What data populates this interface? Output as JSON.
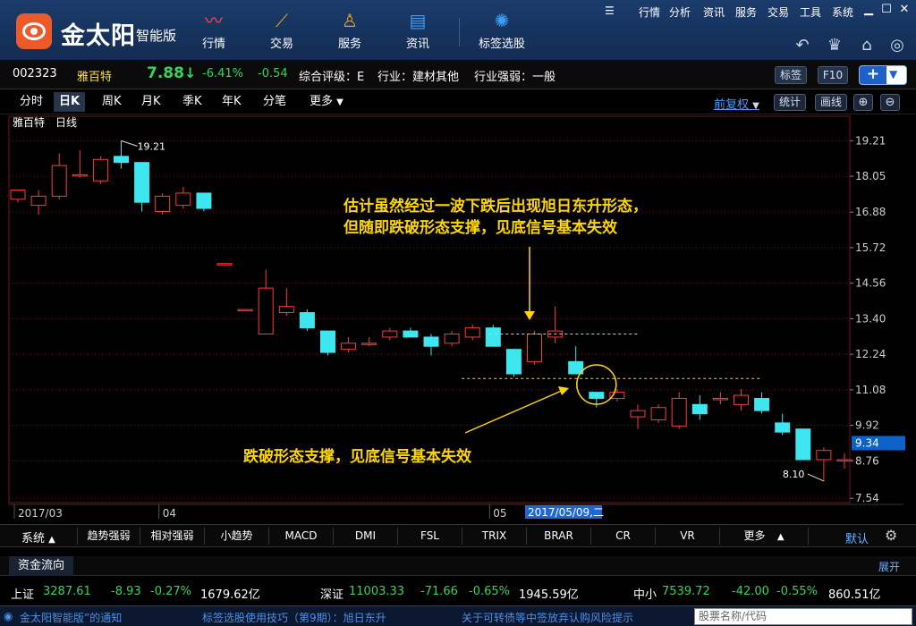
{
  "app": {
    "logo_text": "金太阳",
    "logo_subtitle": "智能版"
  },
  "nav": [
    {
      "label": "行情",
      "icon": "trend-line-icon"
    },
    {
      "label": "交易",
      "icon": "trade-icon"
    },
    {
      "label": "服务",
      "icon": "person-icon"
    },
    {
      "label": "资讯",
      "icon": "news-icon"
    },
    {
      "label": "标签选股",
      "icon": "bulb-icon"
    }
  ],
  "system_menu": [
    "行情",
    "分析",
    "资讯",
    "服务",
    "交易",
    "工具",
    "系统"
  ],
  "stock": {
    "code": "002323",
    "name": "雅百特",
    "price": "7.88",
    "arrow": "↓",
    "change_pct": "-6.41%",
    "change": "-0.54",
    "rating": "综合评级：E",
    "industry": "行业：建材其他",
    "industry_strength": "行业强弱：一般"
  },
  "info_buttons": {
    "tag": "标签",
    "f10": "F10",
    "plus": "+"
  },
  "period_tabs": [
    "分时",
    "日K",
    "周K",
    "月K",
    "季K",
    "年K",
    "分笔",
    "更多"
  ],
  "active_period": "日K",
  "right_tools": {
    "adjust": "前复权",
    "stats": "统计",
    "draw": "画线"
  },
  "chart_data": {
    "type": "candlestick",
    "title": "雅百特",
    "subtitle": "日线",
    "ylim": [
      7.34,
      19.6
    ],
    "y_ticks": [
      "19.21",
      "18.05",
      "16.88",
      "15.72",
      "14.56",
      "13.40",
      "12.24",
      "11.08",
      "9.92",
      "8.76",
      "7.54"
    ],
    "x_labels": [
      {
        "label": "2017/03",
        "index": 0
      },
      {
        "label": "04",
        "index": 7
      },
      {
        "label": "05",
        "index": 23
      }
    ],
    "crosshair_date": "2017/05/09,二",
    "current_value_tag": "9.34",
    "high_label": "19.21",
    "low_label": "8.10",
    "candles": [
      {
        "o": 17.3,
        "h": 17.6,
        "l": 17.2,
        "c": 17.6
      },
      {
        "o": 17.1,
        "h": 17.6,
        "l": 16.8,
        "c": 17.4
      },
      {
        "o": 17.4,
        "h": 18.8,
        "l": 17.3,
        "c": 18.4
      },
      {
        "o": 18.1,
        "h": 18.9,
        "l": 18.0,
        "c": 18.1
      },
      {
        "o": 17.9,
        "h": 18.7,
        "l": 17.8,
        "c": 18.6
      },
      {
        "o": 18.7,
        "h": 19.21,
        "l": 18.3,
        "c": 18.5
      },
      {
        "o": 18.5,
        "h": 18.5,
        "l": 16.9,
        "c": 17.2
      },
      {
        "o": 16.9,
        "h": 17.5,
        "l": 16.8,
        "c": 17.4
      },
      {
        "o": 17.1,
        "h": 17.7,
        "l": 17.0,
        "c": 17.5
      },
      {
        "o": 17.5,
        "h": 17.5,
        "l": 16.9,
        "c": 17.0
      },
      {
        "o": 15.2,
        "h": 15.2,
        "l": 15.2,
        "c": 15.2
      },
      {
        "o": 13.7,
        "h": 13.7,
        "l": 13.7,
        "c": 13.7
      },
      {
        "o": 12.9,
        "h": 15.0,
        "l": 12.9,
        "c": 14.4
      },
      {
        "o": 13.6,
        "h": 14.4,
        "l": 13.5,
        "c": 13.8
      },
      {
        "o": 13.6,
        "h": 13.7,
        "l": 13.0,
        "c": 13.1
      },
      {
        "o": 13.0,
        "h": 13.0,
        "l": 12.2,
        "c": 12.3
      },
      {
        "o": 12.4,
        "h": 12.8,
        "l": 12.3,
        "c": 12.6
      },
      {
        "o": 12.6,
        "h": 12.8,
        "l": 12.5,
        "c": 12.6
      },
      {
        "o": 12.8,
        "h": 13.1,
        "l": 12.7,
        "c": 13.0
      },
      {
        "o": 13.0,
        "h": 13.1,
        "l": 12.8,
        "c": 12.8
      },
      {
        "o": 12.8,
        "h": 12.9,
        "l": 12.2,
        "c": 12.5
      },
      {
        "o": 12.6,
        "h": 13.0,
        "l": 12.5,
        "c": 12.9
      },
      {
        "o": 12.8,
        "h": 13.2,
        "l": 12.7,
        "c": 13.1
      },
      {
        "o": 13.1,
        "h": 13.2,
        "l": 12.5,
        "c": 12.5
      },
      {
        "o": 12.4,
        "h": 12.4,
        "l": 11.5,
        "c": 11.6
      },
      {
        "o": 12.0,
        "h": 13.0,
        "l": 11.9,
        "c": 12.9
      },
      {
        "o": 12.8,
        "h": 13.8,
        "l": 12.6,
        "c": 13.0
      },
      {
        "o": 12.0,
        "h": 12.5,
        "l": 11.6,
        "c": 11.6
      },
      {
        "o": 11.0,
        "h": 11.0,
        "l": 10.5,
        "c": 10.8
      },
      {
        "o": 10.8,
        "h": 11.1,
        "l": 10.7,
        "c": 11.0
      },
      {
        "o": 10.2,
        "h": 10.6,
        "l": 9.8,
        "c": 10.4
      },
      {
        "o": 10.1,
        "h": 10.6,
        "l": 10.0,
        "c": 10.5
      },
      {
        "o": 9.9,
        "h": 11.0,
        "l": 9.8,
        "c": 10.8
      },
      {
        "o": 10.6,
        "h": 10.9,
        "l": 10.1,
        "c": 10.3
      },
      {
        "o": 10.8,
        "h": 11.0,
        "l": 10.6,
        "c": 10.8
      },
      {
        "o": 10.6,
        "h": 11.1,
        "l": 10.4,
        "c": 10.9
      },
      {
        "o": 10.8,
        "h": 11.0,
        "l": 10.3,
        "c": 10.4
      },
      {
        "o": 10.0,
        "h": 10.3,
        "l": 9.6,
        "c": 9.7
      },
      {
        "o": 9.8,
        "h": 9.8,
        "l": 8.8,
        "c": 8.8
      },
      {
        "o": 8.8,
        "h": 9.2,
        "l": 8.1,
        "c": 9.1
      },
      {
        "o": 8.8,
        "h": 9.0,
        "l": 8.5,
        "c": 8.8
      }
    ],
    "annotations": [
      {
        "text": "估计虽然经过一波下跌后出现旭日东升形态，",
        "color": "#ffd700"
      },
      {
        "text": "但随即跌破形态支撑，见底信号基本失效",
        "color": "#ffd700"
      },
      {
        "text": "跌破形态支撑，见底信号基本失效",
        "color": "#ffd700"
      }
    ],
    "dashed_levels": [
      12.9,
      11.45
    ],
    "colors": {
      "up": "#ff3b3b",
      "down": "#3ee6f0",
      "grid": "#7a1010",
      "axis_text": "#cfcfcf"
    }
  },
  "indicator_bar": {
    "system_label": "系统",
    "tabs": [
      "趋势强弱",
      "相对强弱",
      "小趋势",
      "MACD",
      "DMI",
      "FSL",
      "TRIX",
      "BRAR",
      "CR",
      "VR",
      "更多"
    ],
    "default_label": "默认"
  },
  "fund_flow": {
    "title": "资金流向",
    "expand": "展开"
  },
  "indices": [
    {
      "name": "上证",
      "value": "3287.61",
      "change": "-8.93",
      "pct": "-0.27%",
      "amount": "1679.62亿"
    },
    {
      "name": "深证",
      "value": "11003.33",
      "change": "-71.66",
      "pct": "-0.65%",
      "amount": "1945.59亿"
    },
    {
      "name": "中小",
      "value": "7539.72",
      "change": "-42.00",
      "pct": "-0.55%",
      "amount": "860.51亿"
    }
  ],
  "status_bar": {
    "notice": "金太阳智能版”的通知",
    "tip": "标签选股使用技巧（第9期）：旭日东升",
    "news": "关于可转债等中签放弃认购风险提示",
    "search_placeholder": "股票名称/代码"
  }
}
